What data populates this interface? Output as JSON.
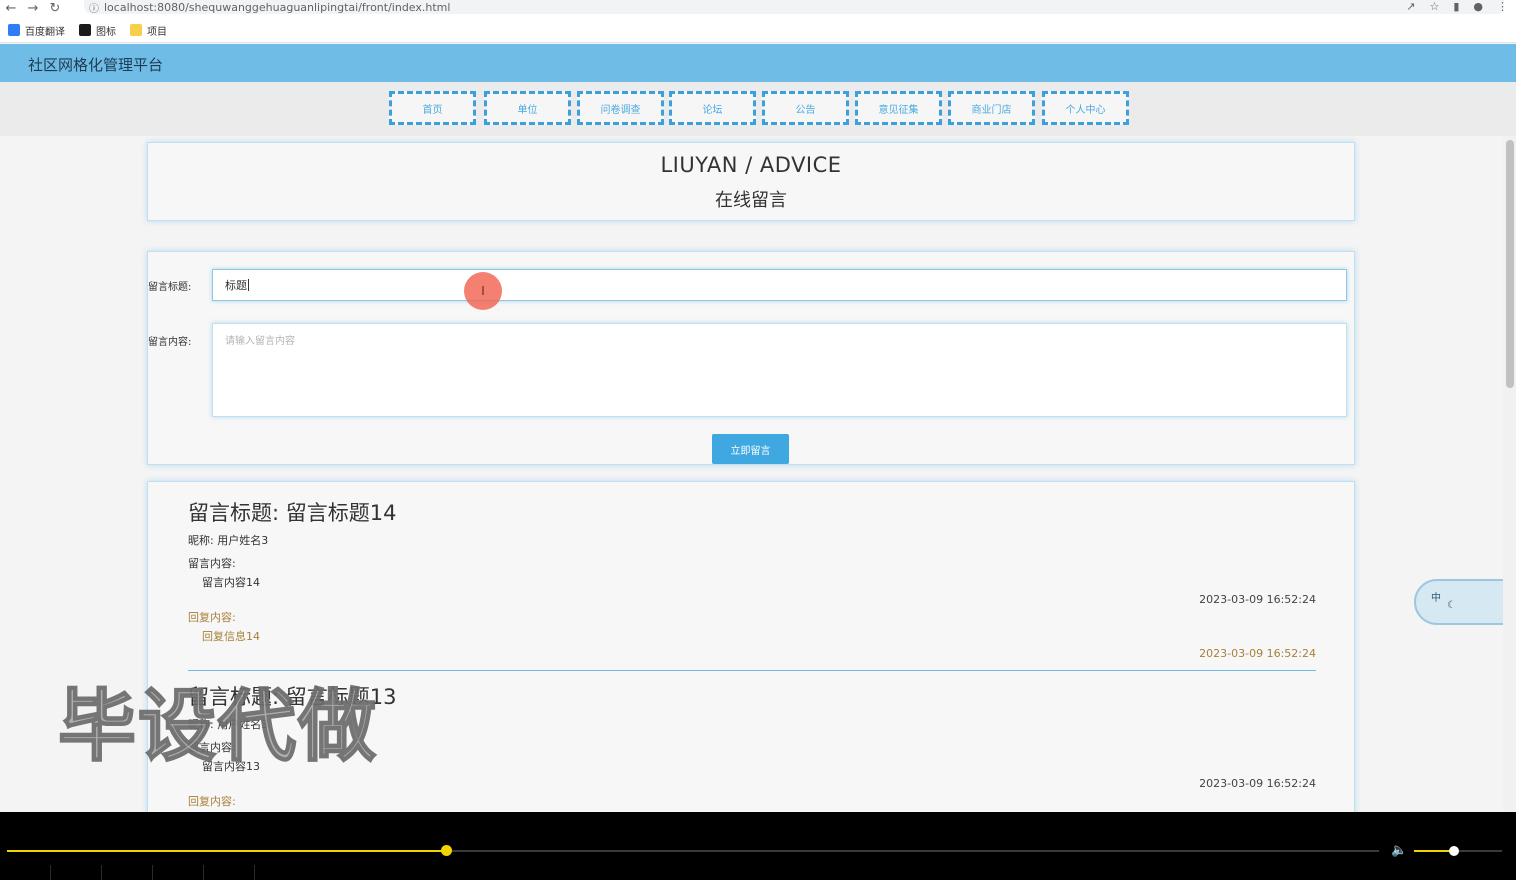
{
  "browser": {
    "url": "localhost:8080/shequwanggehuaguanlipingtai/front/index.html",
    "bookmarks": [
      {
        "label": "百度翻译",
        "color": "#2e7cf6"
      },
      {
        "label": "图标",
        "color": "#1b1b1b"
      },
      {
        "label": "项目",
        "color": "#f7cf4a"
      }
    ]
  },
  "site": {
    "title": "社区网格化管理平台",
    "nav": [
      "首页",
      "单位",
      "问卷调查",
      "论坛",
      "公告",
      "意见征集",
      "商业门店",
      "个人中心"
    ]
  },
  "hero": {
    "title_en": "LIUYAN / ADVICE",
    "title_cn": "在线留言"
  },
  "form": {
    "title_label": "留言标题:",
    "title_value": "标题",
    "content_label": "留言内容:",
    "content_placeholder": "请输入留言内容",
    "submit_label": "立即留言"
  },
  "messages": [
    {
      "title": "留言标题: 留言标题14",
      "nickname": "昵称: 用户姓名3",
      "content_label": "留言内容:",
      "content": "留言内容14",
      "date": "2023-03-09 16:52:24",
      "reply_label": "回复内容:",
      "reply": "回复信息14",
      "reply_date": "2023-03-09 16:52:24"
    },
    {
      "title": "留言标题: 留言标题13",
      "nickname": "昵称: 用户姓名3",
      "content_label": "留言内容:",
      "content": "留言内容13",
      "date": "2023-03-09 16:52:24",
      "reply_label": "回复内容:"
    }
  ],
  "overlay": {
    "watermark": "毕设代做",
    "ime_label": "中"
  },
  "player": {
    "progress": 0.32,
    "volume": 0.45
  },
  "colors": {
    "header": "#6fbde6",
    "accent": "#3fa8e0",
    "reply": "#a8803a",
    "player_accent": "#f2d400"
  }
}
